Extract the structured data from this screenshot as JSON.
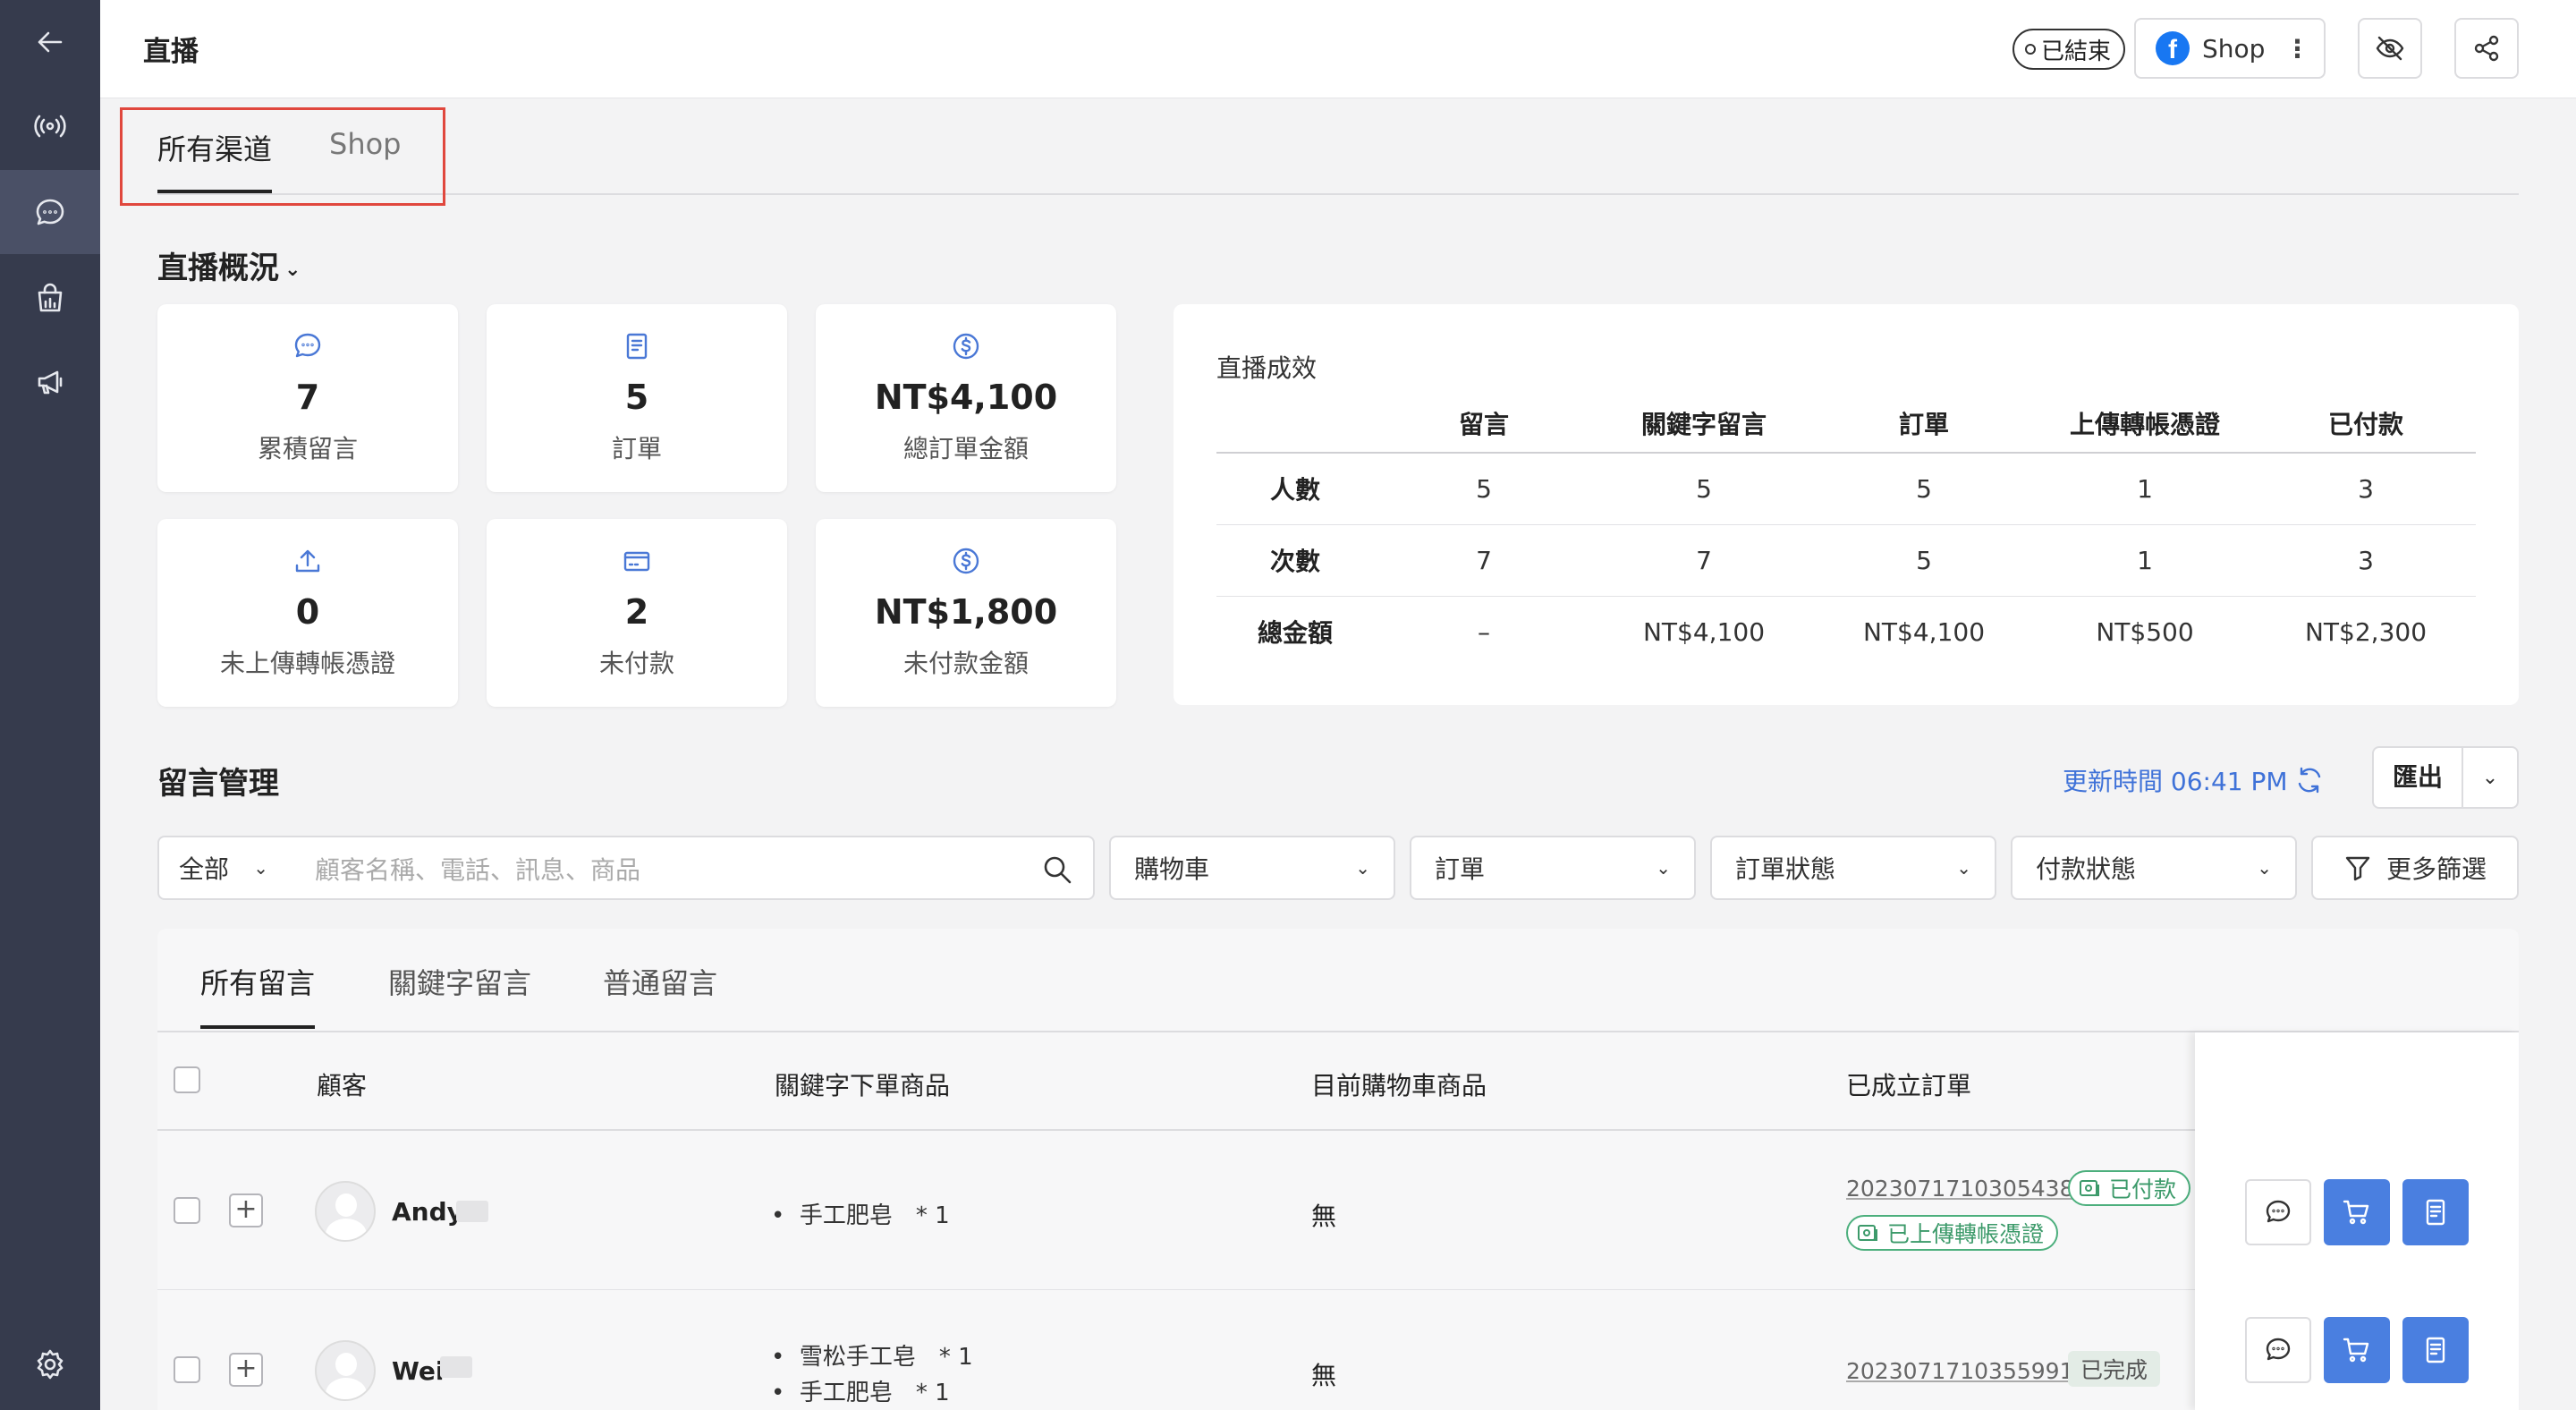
{
  "header": {
    "title": "直播",
    "status": "已結束",
    "channel_button": "Shop"
  },
  "channel_tabs": [
    "所有渠道",
    "Shop"
  ],
  "overview": {
    "title": "直播概況",
    "stats": [
      {
        "icon": "chat-bubble-icon",
        "value": "7",
        "label": "累積留言"
      },
      {
        "icon": "order-clipboard-icon",
        "value": "5",
        "label": "訂單"
      },
      {
        "icon": "dollar-circle-icon",
        "value": "NT$4,100",
        "label": "總訂單金額"
      },
      {
        "icon": "upload-icon",
        "value": "0",
        "label": "未上傳轉帳憑證"
      },
      {
        "icon": "credit-card-icon",
        "value": "2",
        "label": "未付款"
      },
      {
        "icon": "dollar-circle-icon",
        "value": "NT$1,800",
        "label": "未付款金額"
      }
    ]
  },
  "performance": {
    "title": "直播成效",
    "columns": [
      "留言",
      "關鍵字留言",
      "訂單",
      "上傳轉帳憑證",
      "已付款"
    ],
    "rows": [
      {
        "label": "人數",
        "values": [
          "5",
          "5",
          "5",
          "1",
          "3"
        ]
      },
      {
        "label": "次數",
        "values": [
          "7",
          "7",
          "5",
          "1",
          "3"
        ]
      },
      {
        "label": "總金額",
        "values": [
          "–",
          "NT$4,100",
          "NT$4,100",
          "NT$500",
          "NT$2,300"
        ]
      }
    ]
  },
  "comments": {
    "title": "留言管理",
    "update_time": "更新時間 06:41 PM",
    "export_label": "匯出",
    "filters": {
      "scope": "全部",
      "search_placeholder": "顧客名稱、電話、訊息、商品",
      "cart": "購物車",
      "order": "訂單",
      "order_status": "訂單狀態",
      "payment_status": "付款狀態",
      "more": "更多篩選"
    },
    "tabs": [
      "所有留言",
      "關鍵字留言",
      "普通留言"
    ],
    "table_headers": {
      "customer": "顧客",
      "keyword_products": "關鍵字下單商品",
      "cart_products": "目前購物車商品",
      "orders": "已成立訂單"
    },
    "rows": [
      {
        "name": "Andy",
        "products": [
          "手工肥皂　* 1"
        ],
        "cart": "無",
        "order_id": "20230717103054382",
        "badges": [
          "已付款",
          "已上傳轉帳憑證"
        ]
      },
      {
        "name": "Wei",
        "products": [
          "雪松手工皂　* 1",
          "手工肥皂　* 1"
        ],
        "cart": "無",
        "order_id": "20230717103559915",
        "status": "已完成"
      }
    ]
  },
  "colors": {
    "sidebar": "#363b4d",
    "accent_blue": "#4a7fe0",
    "link_blue": "#3f72d8",
    "success_green": "#3c9a6a",
    "highlight_red": "#e0473d"
  }
}
